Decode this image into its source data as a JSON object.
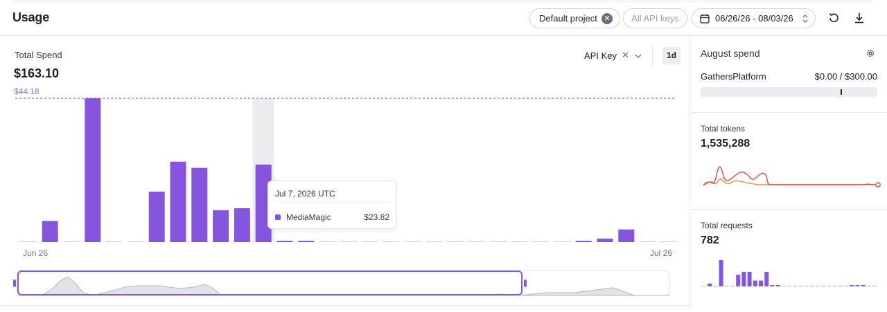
{
  "header": {
    "title": "Usage",
    "project_filter": "Default project",
    "api_keys_filter": "All API keys",
    "date_range": "06/26/26 - 08/03/26"
  },
  "spend": {
    "label": "Total Spend",
    "total": "$163.10",
    "max_label": "$44.18",
    "group_by": "API Key",
    "interval": "1d",
    "x_start": "Jun 26",
    "x_end": "Jul 26"
  },
  "tooltip": {
    "date": "Jul 7, 2026 UTC",
    "series": "MediaMagic",
    "value": "$23.82"
  },
  "sidebar": {
    "august_spend": {
      "title": "August spend",
      "org": "GathersPlatform",
      "amount": "$0.00 / $300.00"
    },
    "tokens": {
      "label": "Total tokens",
      "value": "1,535,288"
    },
    "requests": {
      "label": "Total requests",
      "value": "782"
    }
  },
  "colors": {
    "bar": "#8655e0",
    "max_line": "#9b6bf5",
    "tokens_line_1": "#e04848",
    "tokens_line_2": "#f08c3a"
  },
  "chart_data": {
    "type": "bar",
    "ymax": 44.18,
    "highlight_index": 11,
    "values": [
      0,
      6.5,
      0,
      44.18,
      0,
      0,
      15.5,
      24.7,
      22.8,
      9.8,
      10.4,
      23.82,
      0.3,
      0.3,
      0,
      0,
      0,
      0,
      0,
      0,
      0,
      0,
      0,
      0,
      0,
      0,
      0.3,
      1.1,
      3.9,
      0,
      0
    ]
  },
  "requests_chart": {
    "values": [
      0,
      1,
      0,
      9,
      0,
      0,
      4,
      5,
      5,
      2,
      2,
      5,
      0.2,
      0.2,
      0,
      0,
      0,
      0,
      0,
      0,
      0,
      0,
      0,
      0,
      0,
      0,
      0.2,
      0.3,
      0.3,
      0,
      0
    ]
  }
}
